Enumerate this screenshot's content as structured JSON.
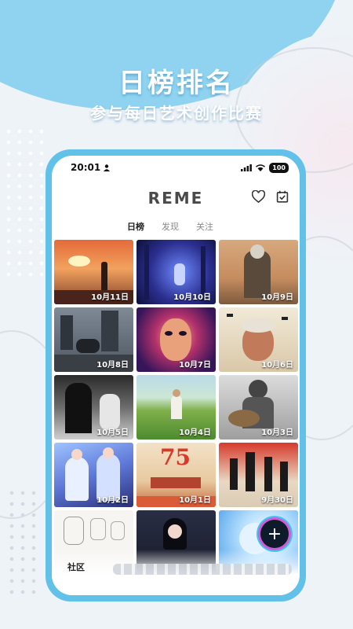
{
  "banner": {
    "title": "日榜排名",
    "subtitle": "参与每日艺术创作比赛"
  },
  "status_bar": {
    "time": "20:01",
    "battery": "100"
  },
  "app": {
    "logo": "REME",
    "icons": [
      "heart-icon",
      "calendar-icon"
    ]
  },
  "tabs": [
    {
      "label": "日榜",
      "active": true
    },
    {
      "label": "发现",
      "active": false
    },
    {
      "label": "关注",
      "active": false
    }
  ],
  "artworks": [
    {
      "date": "10月11日",
      "scene": "sunset-soldier"
    },
    {
      "date": "10月10日",
      "scene": "blue-forest"
    },
    {
      "date": "10月9日",
      "scene": "wolf-soldier"
    },
    {
      "date": "10月8日",
      "scene": "ruins"
    },
    {
      "date": "10月7日",
      "scene": "psychedelic-face"
    },
    {
      "date": "10月6日",
      "scene": "old-man-birds"
    },
    {
      "date": "10月5日",
      "scene": "reaper"
    },
    {
      "date": "10月4日",
      "scene": "field"
    },
    {
      "date": "10月3日",
      "scene": "guitar-soldier"
    },
    {
      "date": "10月2日",
      "scene": "anime-girls"
    },
    {
      "date": "10月1日",
      "scene": "poster-75"
    },
    {
      "date": "9月30日",
      "scene": "red-crowd"
    },
    {
      "date": "",
      "scene": "sketch-sheet"
    },
    {
      "date": "",
      "scene": "dark-girl"
    },
    {
      "date": "",
      "scene": "blue-splash"
    }
  ],
  "poster_text": "75",
  "bottom": {
    "community_label": "社区",
    "fab_label": "+"
  },
  "colors": {
    "accent": "#62c1e8",
    "fab": "#0d1b2a"
  }
}
